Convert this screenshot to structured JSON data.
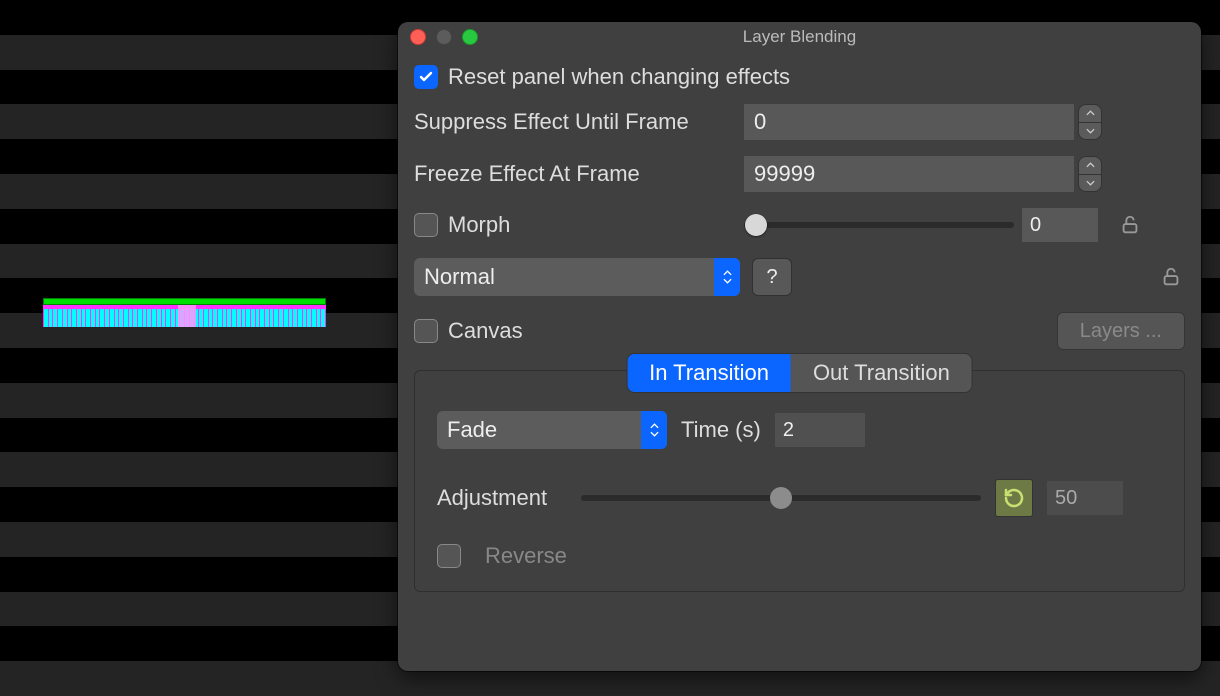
{
  "window": {
    "title": "Layer Blending"
  },
  "checkbox": {
    "reset_label": "Reset panel when changing effects",
    "reset_checked": true,
    "morph_label": "Morph",
    "morph_checked": false,
    "canvas_label": "Canvas",
    "canvas_checked": false,
    "reverse_label": "Reverse",
    "reverse_checked": false
  },
  "fields": {
    "suppress_label": "Suppress Effect Until Frame",
    "suppress_value": "0",
    "freeze_label": "Freeze Effect At Frame",
    "freeze_value": "99999",
    "morph_slider_value": "0"
  },
  "selects": {
    "blend_mode": "Normal",
    "transition_mode": "Fade"
  },
  "buttons": {
    "help_label": "?",
    "layers_label": "Layers ..."
  },
  "tabs": {
    "in_label": "In Transition",
    "out_label": "Out Transition",
    "active": "in"
  },
  "transition": {
    "time_label": "Time (s)",
    "time_value": "2",
    "adjustment_label": "Adjustment",
    "adjustment_value": "50"
  }
}
